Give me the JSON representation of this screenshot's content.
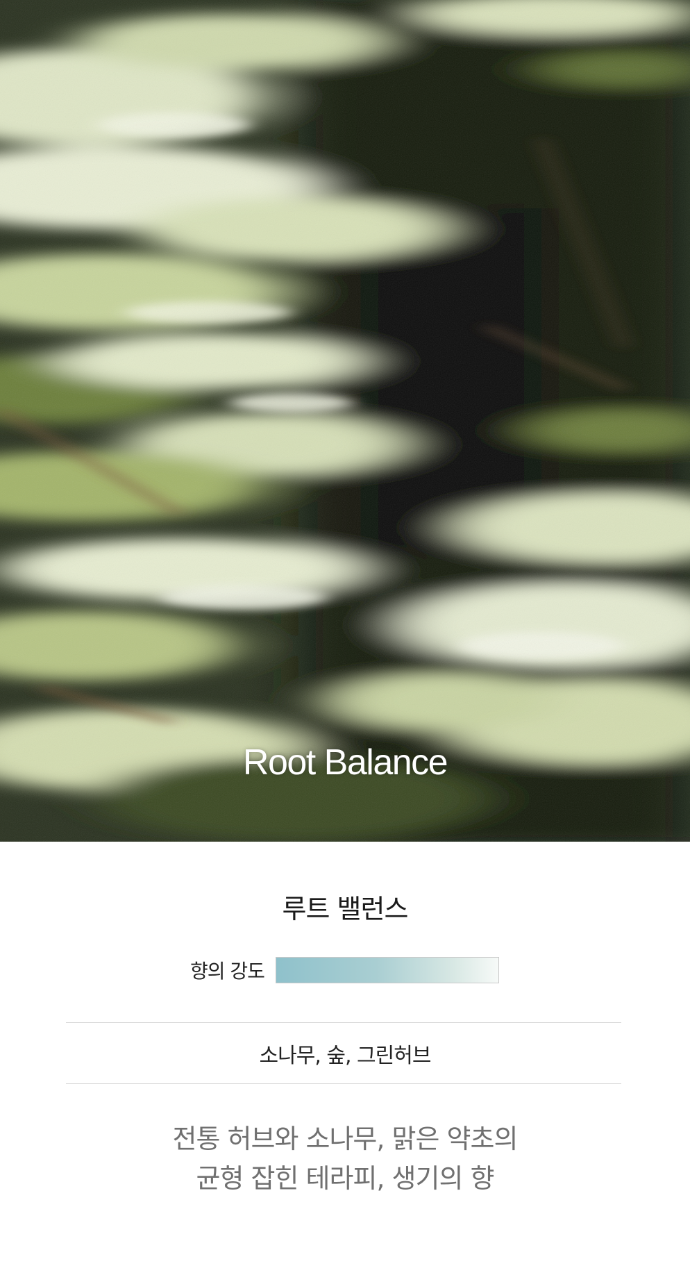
{
  "hero": {
    "title": "Root Balance",
    "image_description_icon": "forest-motion-blur-photo"
  },
  "product": {
    "name": "루트 밸런스",
    "intensity_label": "향의 강도",
    "notes": "소나무, 숲, 그린허브",
    "description_lines": [
      "전통 허브와 소나무, 맑은 약초의",
      "균형 잡힌 테라피, 생기의 향"
    ]
  },
  "colors": {
    "intensity_start": "#8fc1cb",
    "intensity_end": "#f7faf8",
    "divider": "#d9d9d9",
    "description_text": "#707070"
  }
}
